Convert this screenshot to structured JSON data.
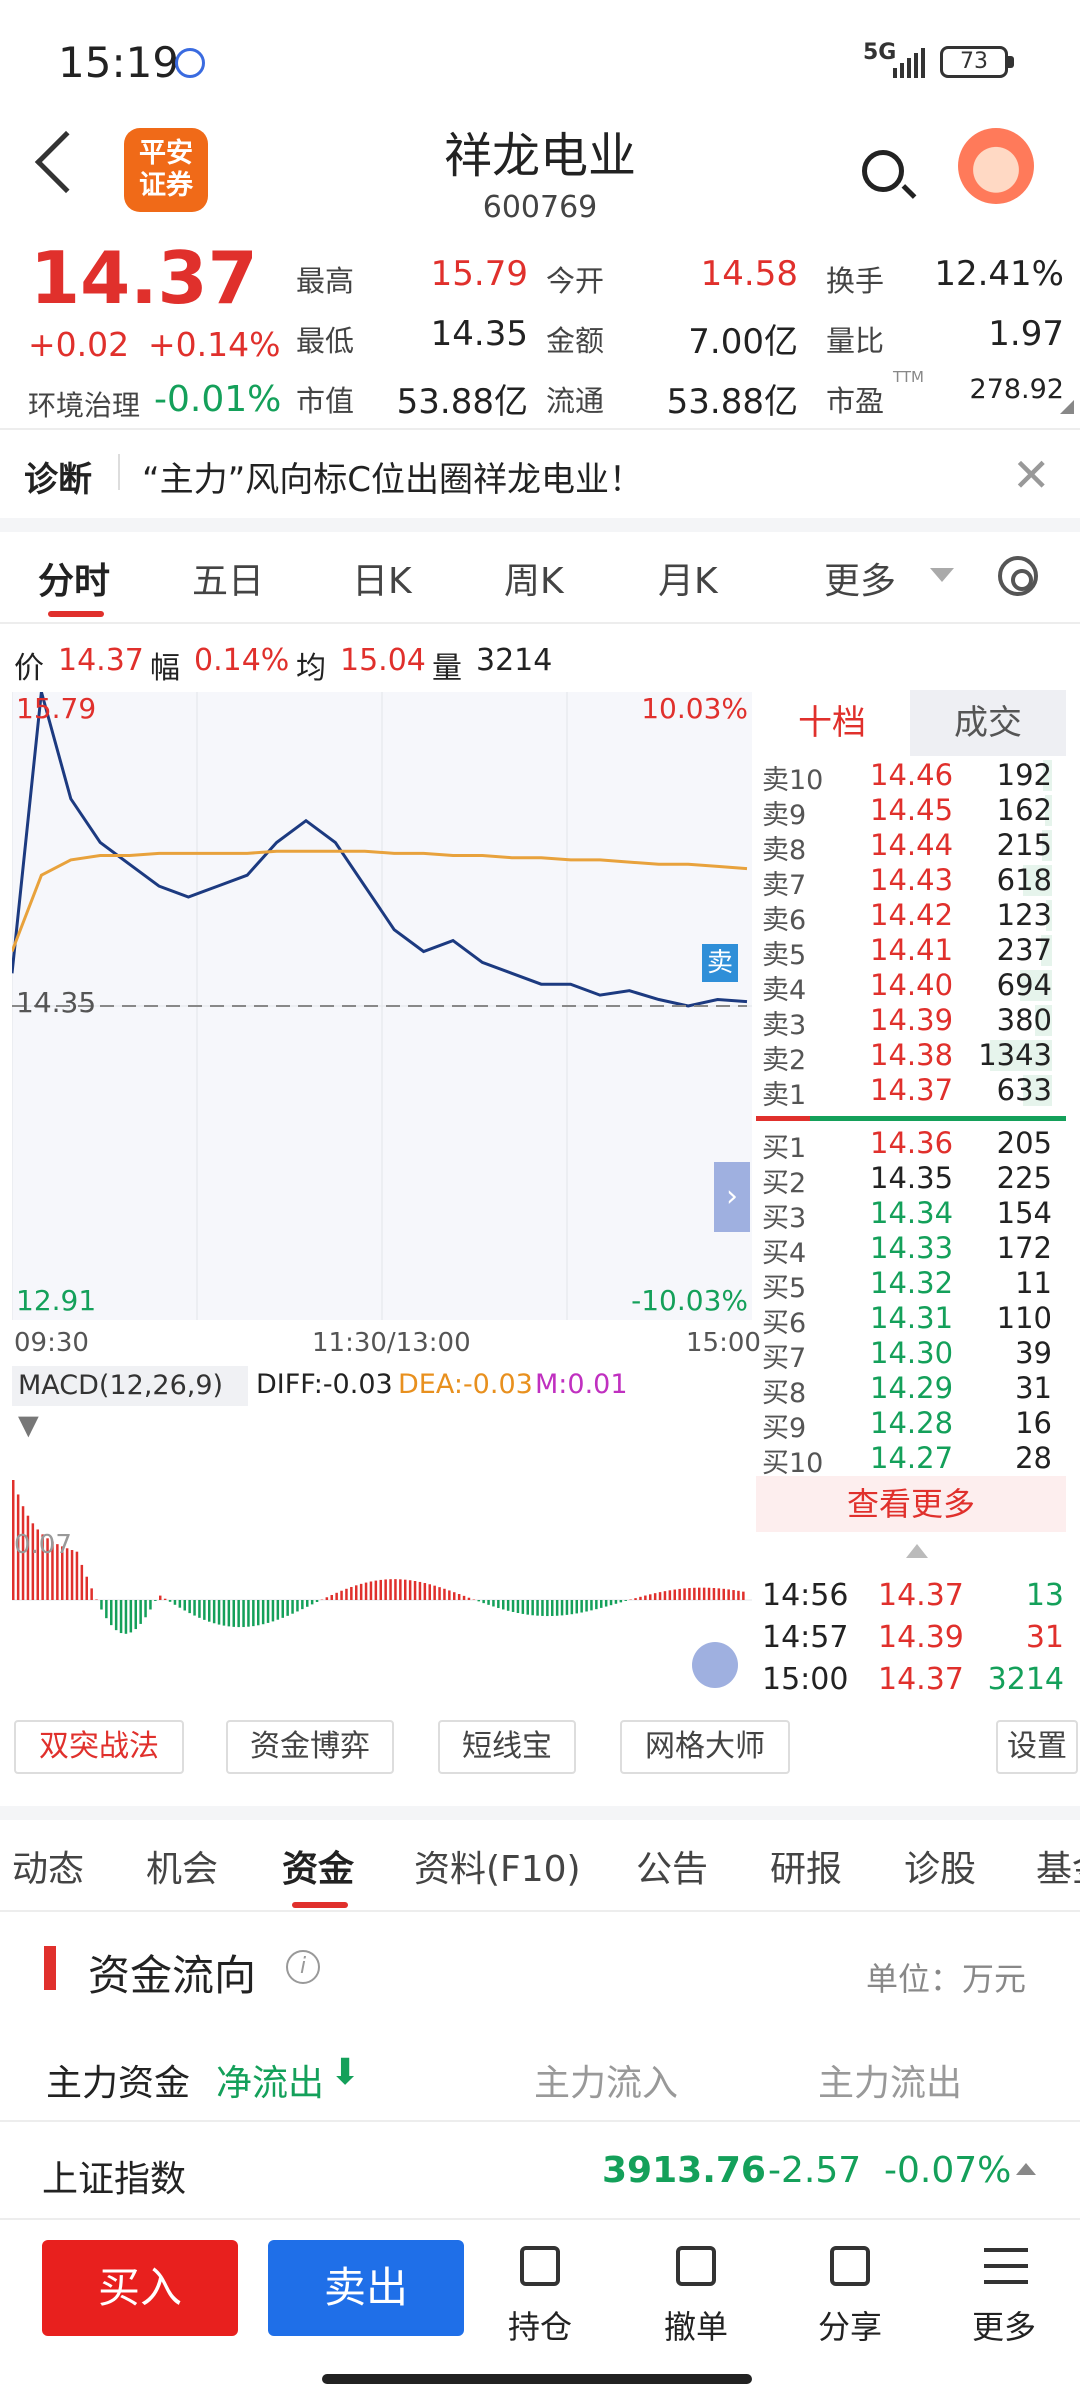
{
  "status_bar": {
    "time": "15:19",
    "signal": "5G",
    "battery": "73"
  },
  "header": {
    "title": "祥龙电业",
    "code": "600769",
    "logo_text": "平安\n证券"
  },
  "quote": {
    "price": "14.37",
    "change": "+0.02",
    "change_pct": "+0.14%",
    "sector_label": "环境治理",
    "sector_change": "-0.01%",
    "stats": [
      {
        "label": "最高",
        "value": "15.79",
        "color": "red"
      },
      {
        "label": "今开",
        "value": "14.58",
        "color": "red"
      },
      {
        "label": "换手",
        "value": "12.41%",
        "color": "dark"
      },
      {
        "label": "最低",
        "value": "14.35",
        "color": "dark"
      },
      {
        "label": "金额",
        "value": "7.00亿",
        "color": "dark"
      },
      {
        "label": "量比",
        "value": "1.97",
        "color": "dark"
      },
      {
        "label": "市值",
        "value": "53.88亿",
        "color": "dark"
      },
      {
        "label": "流通",
        "value": "53.88亿",
        "color": "dark"
      },
      {
        "label": "市盈",
        "value": "278.92",
        "color": "dark"
      }
    ],
    "ttm": "TTM"
  },
  "diagnosis": {
    "label": "诊断",
    "text": "“主力”风向标C位出圈祥龙电业！"
  },
  "chart_tabs": [
    "分时",
    "五日",
    "日K",
    "周K",
    "月K",
    "更多"
  ],
  "info_line": {
    "price_label": "价",
    "price": "14.37",
    "amp_label": "幅",
    "amp": "0.14%",
    "avg_label": "均",
    "avg": "15.04",
    "vol_label": "量",
    "vol": "3214"
  },
  "chart_labels": {
    "top_left": "15.79",
    "top_right": "10.03%",
    "mid": "14.35",
    "bottom_left": "12.91",
    "bottom_right": "-10.03%",
    "t_start": "09:30",
    "t_mid": "11:30/13:00",
    "t_end": "15:00",
    "sell_marker": "卖"
  },
  "chart_data": {
    "type": "line",
    "ylim": [
      12.91,
      15.79
    ],
    "series": [
      {
        "values": [
          14.5,
          15.79,
          15.3,
          15.1,
          15.0,
          14.9,
          14.85,
          14.9,
          14.95,
          15.1,
          15.2,
          15.1,
          14.9,
          14.7,
          14.6,
          14.65,
          14.55,
          14.5,
          14.45,
          14.45,
          14.4,
          14.42,
          14.38,
          14.35,
          14.38,
          14.37
        ]
      },
      {
        "values": [
          14.6,
          14.95,
          15.02,
          15.04,
          15.04,
          15.05,
          15.05,
          15.05,
          15.05,
          15.06,
          15.06,
          15.06,
          15.06,
          15.05,
          15.05,
          15.04,
          15.04,
          15.03,
          15.03,
          15.02,
          15.02,
          15.01,
          15.0,
          15.0,
          14.99,
          14.98
        ]
      }
    ]
  },
  "macd": {
    "label": "MACD(12,26,9)",
    "diff": "DIFF:-0.03",
    "dea": "DEA:-0.03",
    "m": "M:0.01",
    "axis": "0.07"
  },
  "orderbook": {
    "tabs": [
      "十档",
      "成交"
    ],
    "asks": [
      {
        "label": "卖10",
        "price": "14.46",
        "vol": "192",
        "c": "red",
        "bar": 0.14
      },
      {
        "label": "卖9",
        "price": "14.45",
        "vol": "162",
        "c": "red",
        "bar": 0.12
      },
      {
        "label": "卖8",
        "price": "14.44",
        "vol": "215",
        "c": "red",
        "bar": 0.16
      },
      {
        "label": "卖7",
        "price": "14.43",
        "vol": "618",
        "c": "red",
        "bar": 0.46
      },
      {
        "label": "卖6",
        "price": "14.42",
        "vol": "123",
        "c": "red",
        "bar": 0.09
      },
      {
        "label": "卖5",
        "price": "14.41",
        "vol": "237",
        "c": "red",
        "bar": 0.18
      },
      {
        "label": "卖4",
        "price": "14.40",
        "vol": "694",
        "c": "red",
        "bar": 0.52
      },
      {
        "label": "卖3",
        "price": "14.39",
        "vol": "380",
        "c": "red",
        "bar": 0.28
      },
      {
        "label": "卖2",
        "price": "14.38",
        "vol": "1343",
        "c": "red",
        "bar": 1.0
      },
      {
        "label": "卖1",
        "price": "14.37",
        "vol": "633",
        "c": "red",
        "bar": 0.47
      }
    ],
    "bids": [
      {
        "label": "买1",
        "price": "14.36",
        "vol": "205",
        "c": "red"
      },
      {
        "label": "买2",
        "price": "14.35",
        "vol": "225",
        "c": "dark"
      },
      {
        "label": "买3",
        "price": "14.34",
        "vol": "154",
        "c": "green"
      },
      {
        "label": "买4",
        "price": "14.33",
        "vol": "172",
        "c": "green"
      },
      {
        "label": "买5",
        "price": "14.32",
        "vol": "11",
        "c": "green"
      },
      {
        "label": "买6",
        "price": "14.31",
        "vol": "110",
        "c": "green"
      },
      {
        "label": "买7",
        "price": "14.30",
        "vol": "39",
        "c": "green"
      },
      {
        "label": "买8",
        "price": "14.29",
        "vol": "31",
        "c": "green"
      },
      {
        "label": "买9",
        "price": "14.28",
        "vol": "16",
        "c": "green"
      },
      {
        "label": "买10",
        "price": "14.27",
        "vol": "28",
        "c": "green"
      }
    ],
    "see_more": "查看更多",
    "trades": [
      {
        "time": "14:56",
        "price": "14.37",
        "vol": "13",
        "pc": "red",
        "vc": "green"
      },
      {
        "time": "14:57",
        "price": "14.39",
        "vol": "31",
        "pc": "red",
        "vc": "red"
      },
      {
        "time": "15:00",
        "price": "14.37",
        "vol": "3214",
        "pc": "red",
        "vc": "green"
      }
    ]
  },
  "strategies": [
    "双突战法",
    "资金博弈",
    "短线宝",
    "网格大师",
    "设置"
  ],
  "section_tabs": [
    "动态",
    "机会",
    "资金",
    "资料(F10)",
    "公告",
    "研报",
    "诊股",
    "基金"
  ],
  "fund": {
    "title": "资金流向",
    "unit": "单位：万元",
    "main_label": "主力资金",
    "net": "净流出",
    "inflow": "主力流入",
    "outflow": "主力流出"
  },
  "index": {
    "name": "上证指数",
    "value": "3913.76",
    "change": "-2.57",
    "pct": "-0.07%"
  },
  "bottom": {
    "buy": "买入",
    "sell": "卖出",
    "items": [
      "持仓",
      "撤单",
      "分享",
      "更多"
    ]
  }
}
